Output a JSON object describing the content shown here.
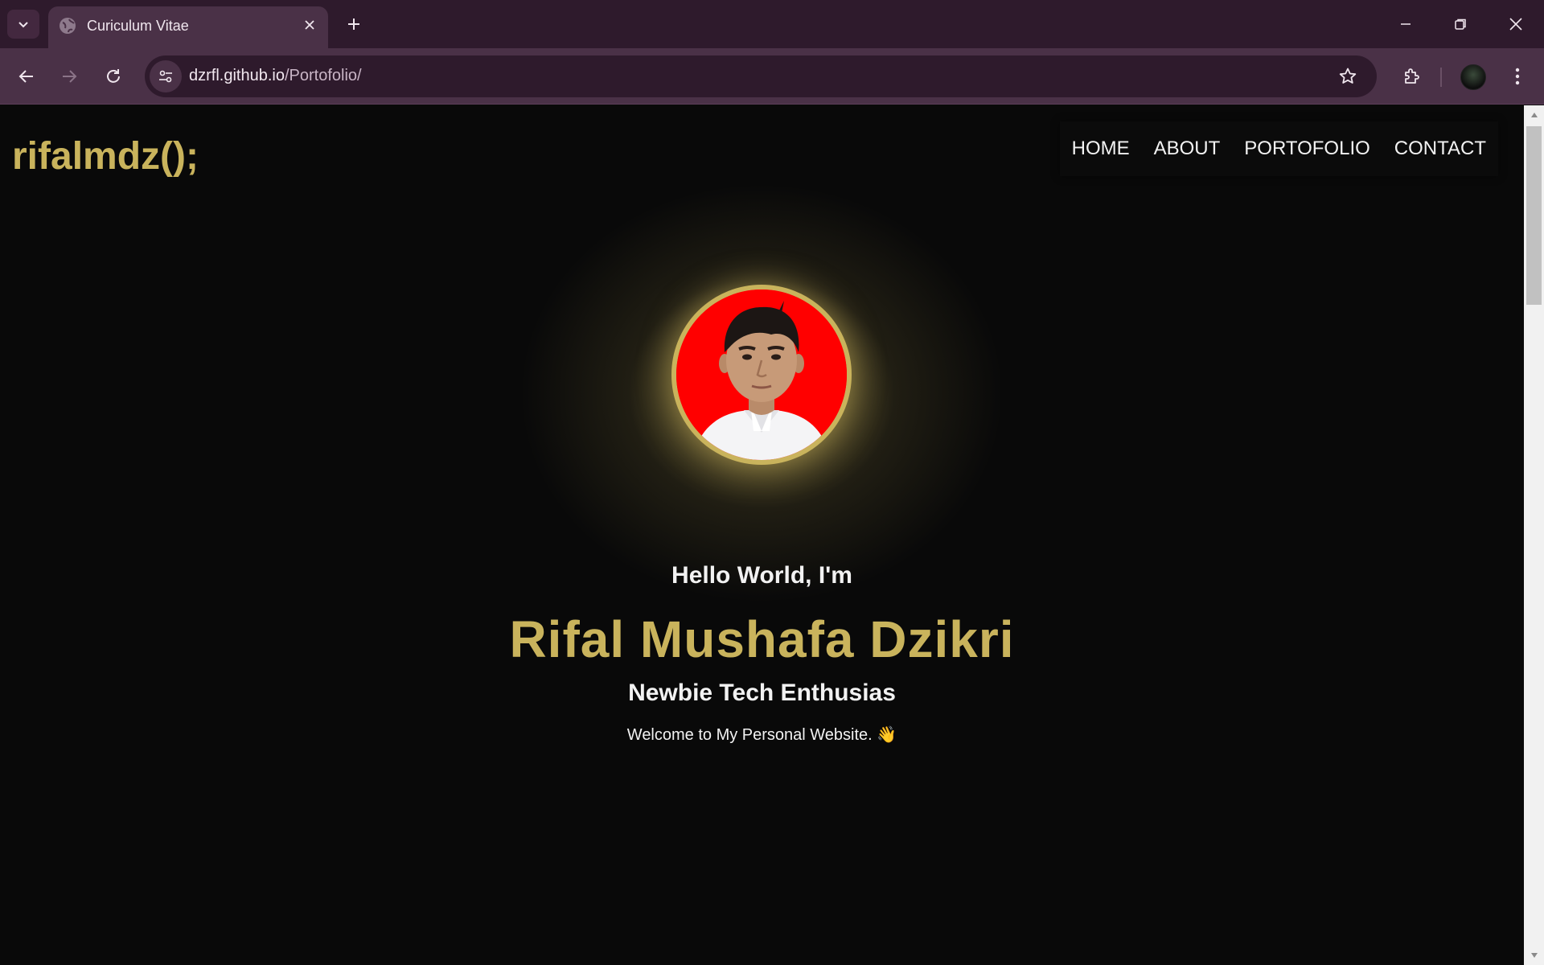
{
  "browser": {
    "tab": {
      "title": "Curiculum Vitae"
    },
    "address": {
      "domain": "dzrfl.github.io",
      "path": "/Portofolio/"
    }
  },
  "site": {
    "logo": "rifalmdz();",
    "nav": [
      "HOME",
      "ABOUT",
      "PORTOFOLIO",
      "CONTACT"
    ],
    "hero": {
      "greeting": "Hello World, I'm",
      "name": "Rifal Mushafa Dzikri",
      "role": "Newbie Tech Enthusias",
      "welcome": "Welcome to My Personal Website. 👋"
    }
  },
  "colors": {
    "accent": "#c9b35c",
    "background": "#090909",
    "chrome": "#2e1a2c",
    "toolbar": "#4a3147"
  },
  "icons": [
    "tab-search-icon",
    "globe-icon",
    "close-icon",
    "plus-icon",
    "minimize-icon",
    "restore-icon",
    "back-icon",
    "forward-icon",
    "reload-icon",
    "site-settings-icon",
    "star-icon",
    "extensions-icon",
    "kebab-menu-icon"
  ]
}
